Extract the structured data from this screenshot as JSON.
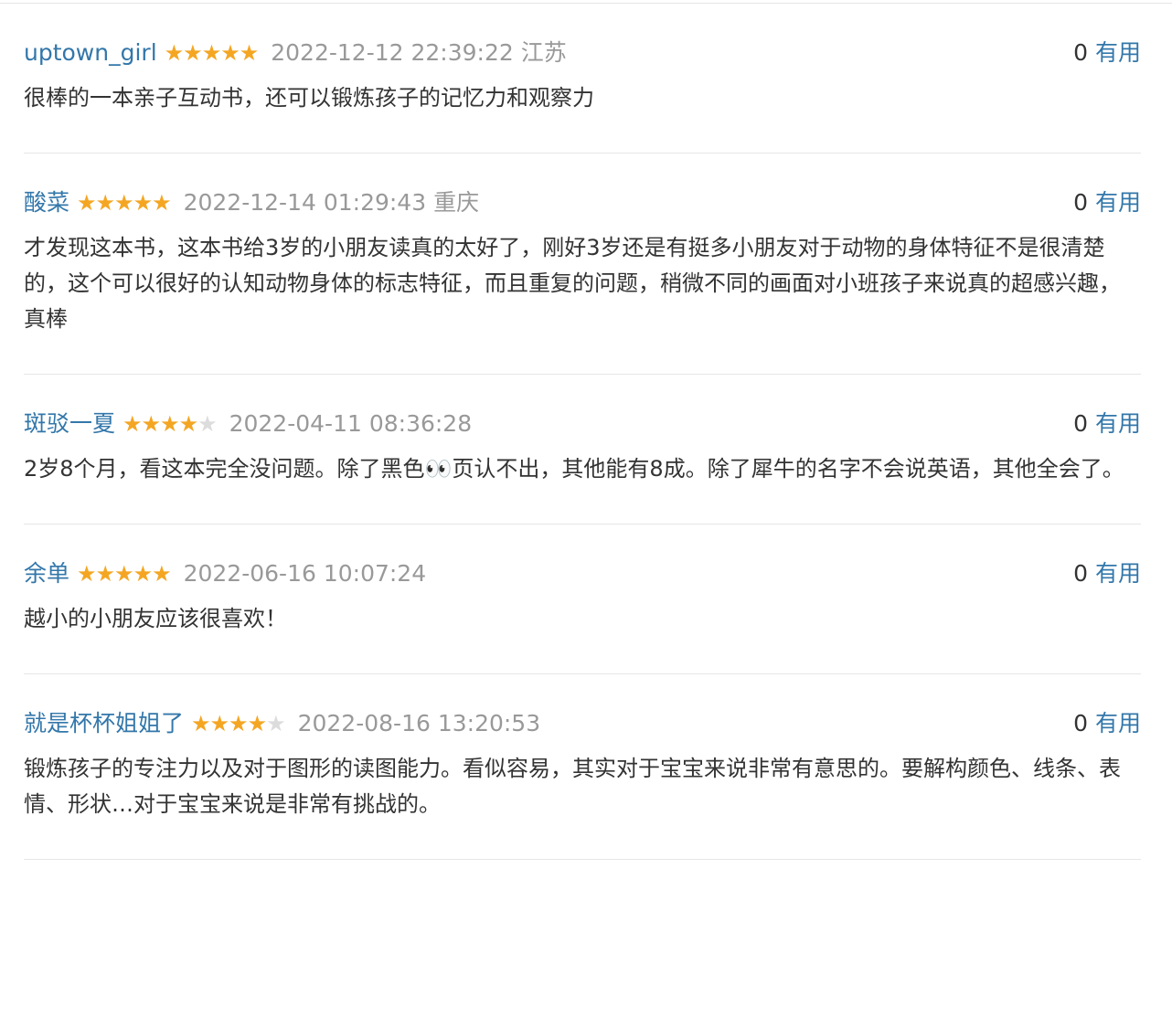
{
  "reviews": [
    {
      "user": "uptown_girl",
      "rating": 5,
      "time": "2022-12-12 22:39:22",
      "location": "江苏",
      "votes": "0",
      "useful": "有用",
      "text": "很棒的一本亲子互动书，还可以锻炼孩子的记忆力和观察力"
    },
    {
      "user": "酸菜",
      "rating": 5,
      "time": "2022-12-14 01:29:43",
      "location": "重庆",
      "votes": "0",
      "useful": "有用",
      "text": "才发现这本书，这本书给3岁的小朋友读真的太好了，刚好3岁还是有挺多小朋友对于动物的身体特征不是很清楚的，这个可以很好的认知动物身体的标志特征，而且重复的问题，稍微不同的画面对小班孩子来说真的超感兴趣，真棒"
    },
    {
      "user": "斑驳一夏",
      "rating": 4,
      "time": "2022-04-11 08:36:28",
      "location": "",
      "votes": "0",
      "useful": "有用",
      "text": "2岁8个月，看这本完全没问题。除了黑色👀页认不出，其他能有8成。除了犀牛的名字不会说英语，其他全会了。"
    },
    {
      "user": "余单",
      "rating": 5,
      "time": "2022-06-16 10:07:24",
      "location": "",
      "votes": "0",
      "useful": "有用",
      "text": "越小的小朋友应该很喜欢！"
    },
    {
      "user": "就是杯杯姐姐了",
      "rating": 4,
      "time": "2022-08-16 13:20:53",
      "location": "",
      "votes": "0",
      "useful": "有用",
      "text": "锻炼孩子的专注力以及对于图形的读图能力。看似容易，其实对于宝宝来说非常有意思的。要解构颜色、线条、表情、形状…对于宝宝来说是非常有挑战的。"
    }
  ]
}
